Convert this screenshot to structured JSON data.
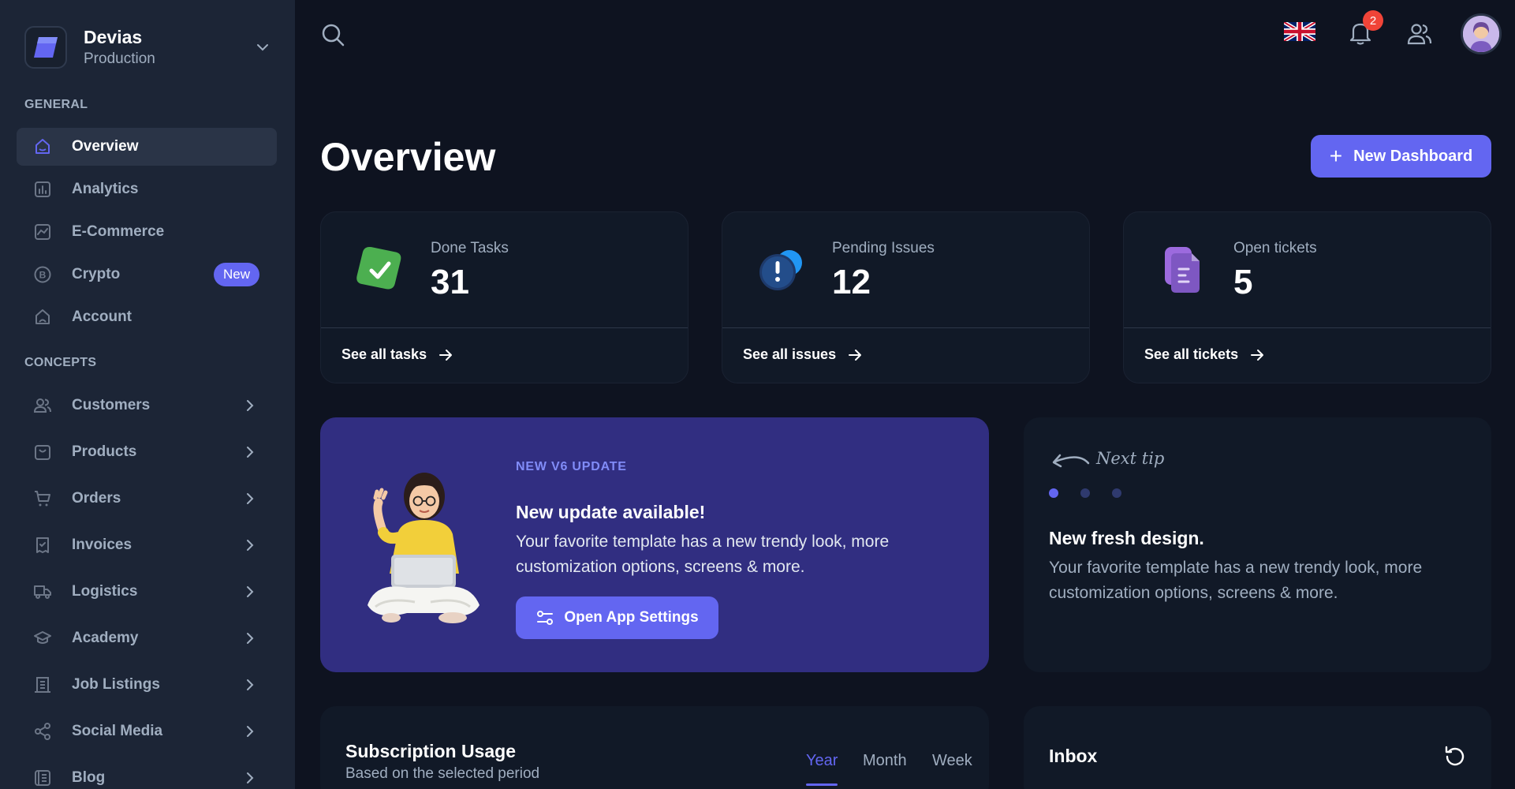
{
  "workspace": {
    "name": "Devias",
    "env": "Production"
  },
  "sidebar": {
    "general_title": "GENERAL",
    "concepts_title": "CONCEPTS",
    "general": [
      {
        "label": "Overview",
        "icon": "home-icon",
        "active": true
      },
      {
        "label": "Analytics",
        "icon": "bar-chart-icon"
      },
      {
        "label": "E-Commerce",
        "icon": "line-chart-icon"
      },
      {
        "label": "Crypto",
        "icon": "bitcoin-icon",
        "badge": "New"
      },
      {
        "label": "Account",
        "icon": "account-icon"
      }
    ],
    "concepts": [
      {
        "label": "Customers",
        "icon": "users-icon"
      },
      {
        "label": "Products",
        "icon": "shopping-bag-icon"
      },
      {
        "label": "Orders",
        "icon": "cart-icon"
      },
      {
        "label": "Invoices",
        "icon": "receipt-check-icon"
      },
      {
        "label": "Logistics",
        "icon": "truck-icon"
      },
      {
        "label": "Academy",
        "icon": "graduation-cap-icon"
      },
      {
        "label": "Job Listings",
        "icon": "building-icon"
      },
      {
        "label": "Social Media",
        "icon": "share-icon"
      },
      {
        "label": "Blog",
        "icon": "blog-icon"
      }
    ]
  },
  "topbar": {
    "notifications_count": "2"
  },
  "header": {
    "title": "Overview",
    "new_dashboard": "New Dashboard"
  },
  "stats": [
    {
      "label": "Done Tasks",
      "value": "31",
      "link": "See all tasks",
      "icon": "done-tasks-icon"
    },
    {
      "label": "Pending Issues",
      "value": "12",
      "link": "See all issues",
      "icon": "pending-issues-icon"
    },
    {
      "label": "Open tickets",
      "value": "5",
      "link": "See all tickets",
      "icon": "open-tickets-icon"
    }
  ],
  "promo": {
    "overline": "NEW V6 UPDATE",
    "title": "New update available!",
    "description": "Your favorite template has a new trendy look, more customization options, screens & more.",
    "button": "Open App Settings"
  },
  "tip": {
    "label": "Next tip",
    "title": "New fresh design.",
    "description": "Your favorite template has a new trendy look, more customization options, screens & more."
  },
  "subscription": {
    "title": "Subscription Usage",
    "subtitle": "Based on the selected period",
    "tabs": [
      "Year",
      "Month",
      "Week"
    ]
  },
  "inbox": {
    "title": "Inbox"
  },
  "colors": {
    "accent": "#6366f1",
    "sidebar": "#1c2536",
    "background": "#0e1320",
    "card": "#111927",
    "promo": "#312e81"
  }
}
